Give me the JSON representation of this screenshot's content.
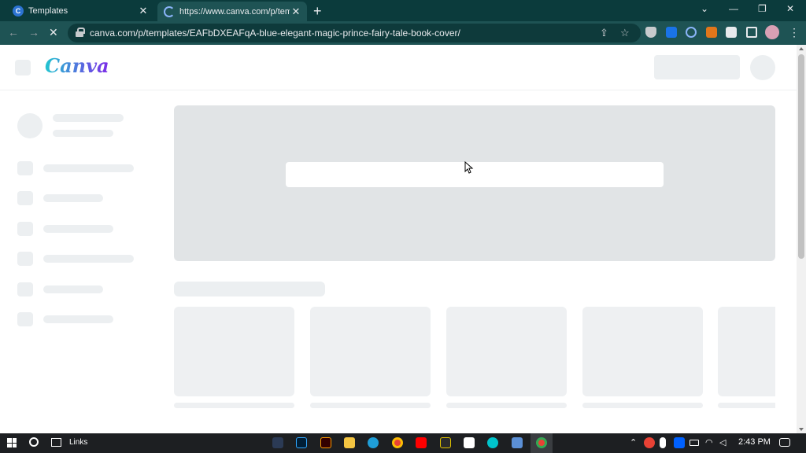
{
  "browser": {
    "tabs": [
      {
        "title": "Templates",
        "close": "✕"
      },
      {
        "title": "https://www.canva.com/p/templ",
        "close": "✕"
      }
    ],
    "new_tab": "+",
    "window_controls": {
      "menu": "⌄",
      "minimize": "—",
      "restore": "❐",
      "close": "✕"
    },
    "nav": {
      "back": "←",
      "forward": "→",
      "stop": "✕"
    },
    "url": "canva.com/p/templates/EAFbDXEAFqA-blue-elegant-magic-prince-fairy-tale-book-cover/",
    "omnibox_icons": {
      "share": "⇪",
      "bookmark": "☆"
    },
    "menu": "⋮"
  },
  "page": {
    "logo": "Canva"
  },
  "taskbar": {
    "links_label": "Links",
    "time": "2:43 PM",
    "colors": {
      "accent": "#3a3d41"
    }
  }
}
